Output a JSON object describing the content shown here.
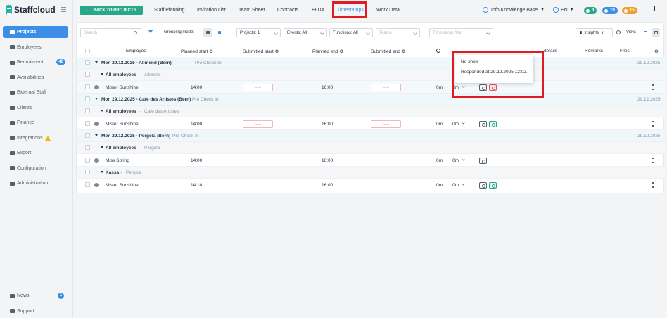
{
  "brand": {
    "name": "Staffcloud"
  },
  "sidebar": {
    "items": [
      {
        "label": "Projects",
        "active": true
      },
      {
        "label": "Employees"
      },
      {
        "label": "Recruitment",
        "badge": "46"
      },
      {
        "label": "Availabilities"
      },
      {
        "label": "External Staff"
      },
      {
        "label": "Clients"
      },
      {
        "label": "Finance"
      },
      {
        "label": "Integrations",
        "warning": true
      },
      {
        "label": "Export"
      },
      {
        "label": "Configuration"
      },
      {
        "label": "Administration"
      }
    ],
    "bottom": [
      {
        "label": "News",
        "badge": "1"
      },
      {
        "label": "Support"
      }
    ]
  },
  "topbar": {
    "back_label": "BACK TO PROJECTS",
    "tabs": [
      "Staff Planning",
      "Invitation List",
      "Team Sheet",
      "Contracts",
      "ELDA",
      "Timestamps",
      "Work Data"
    ],
    "active_tab": "Timestamps",
    "org": "Info Knowledge Base",
    "lang": "EN",
    "pills": [
      {
        "value": "3",
        "color": "#27a889"
      },
      {
        "value": "19",
        "color": "#3d8ee6"
      },
      {
        "value": "15",
        "color": "#f0a030"
      }
    ]
  },
  "toolbar": {
    "search_placeholder": "Search",
    "grouping_label": "Grouping mode:",
    "projects": "Projects: 1",
    "events": "Events: All",
    "functions": "Functions: All",
    "teams_placeholder": "Teams",
    "timestamp_filter_placeholder": "Timestamp filter",
    "insights_label": "Insights",
    "view_label": "View:"
  },
  "table": {
    "headers": {
      "employee": "Employee",
      "planned_start": "Planned start",
      "submitted_start": "Submitted start",
      "planned_end": "Planned end",
      "submitted_end": "Submitted end",
      "details": "details",
      "remarks": "Remarks",
      "files": "Files"
    },
    "groups": [
      {
        "title": "Mon 29.12.2025 - Allmend (Bern)",
        "tag": "Pre Check In",
        "date": "29.12.2025",
        "subgroups": [
          {
            "name": "All employees",
            "location": "Allmend",
            "rows": [
              {
                "employee": "Mister Sunshine",
                "planned_start": "14:00",
                "submitted_start": "--:--",
                "planned_end": "16:00",
                "submitted_end": "--:--",
                "break": "0m",
                "pause": "0m",
                "status": "red"
              }
            ]
          }
        ]
      },
      {
        "title": "Mon 29.12.2025 - Cafe des Artistes (Bern)",
        "tag": "Pre Check In",
        "date": "29.12.2025",
        "subgroups": [
          {
            "name": "All employees",
            "location": "Cafe des Artistes",
            "rows": [
              {
                "employee": "Mister Sunshine",
                "planned_start": "14:00",
                "submitted_start": "--:--",
                "planned_end": "16:00",
                "submitted_end": "--:--",
                "break": "0m",
                "pause": "0m",
                "status": "green"
              }
            ]
          }
        ]
      },
      {
        "title": "Mon 29.12.2025 - Pergola (Bern)",
        "tag": "Pre Check In",
        "date": "29.12.2025",
        "subgroups": [
          {
            "name": "All employees",
            "location": "Pergola",
            "rows": [
              {
                "employee": "Miss Spring",
                "planned_start": "14:00",
                "submitted_start": "",
                "planned_end": "16:00",
                "submitted_end": "",
                "break": "0m",
                "pause": "0m",
                "status": "none"
              }
            ]
          },
          {
            "name": "Kassa",
            "location": "Pergola",
            "rows": [
              {
                "employee": "Mister Sunshine",
                "planned_start": "14:10",
                "submitted_start": "",
                "planned_end": "16:00",
                "submitted_end": "",
                "break": "0m",
                "pause": "0m",
                "status": "green"
              }
            ]
          }
        ]
      }
    ]
  },
  "tooltip": {
    "title": "No show",
    "body": "Responded at 29.12.2025 12:02."
  },
  "colors": {
    "accent": "#3d8ee6",
    "brand": "#27b3a5",
    "back_button": "#27a889",
    "highlight": "#e01b24"
  }
}
